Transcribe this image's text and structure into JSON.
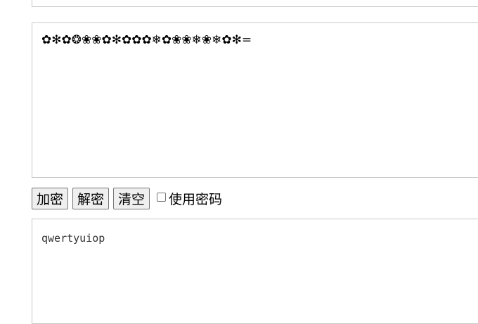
{
  "cipher_text": "✿✻✿❂❀❀✿✻✿✿✿❄✿❀❀❄❀❄✿✻=",
  "buttons": {
    "encrypt": "加密",
    "decrypt": "解密",
    "clear": "清空"
  },
  "use_password_label": "使用密码",
  "use_password_checked": false,
  "plain_text": "qwertyuiop"
}
